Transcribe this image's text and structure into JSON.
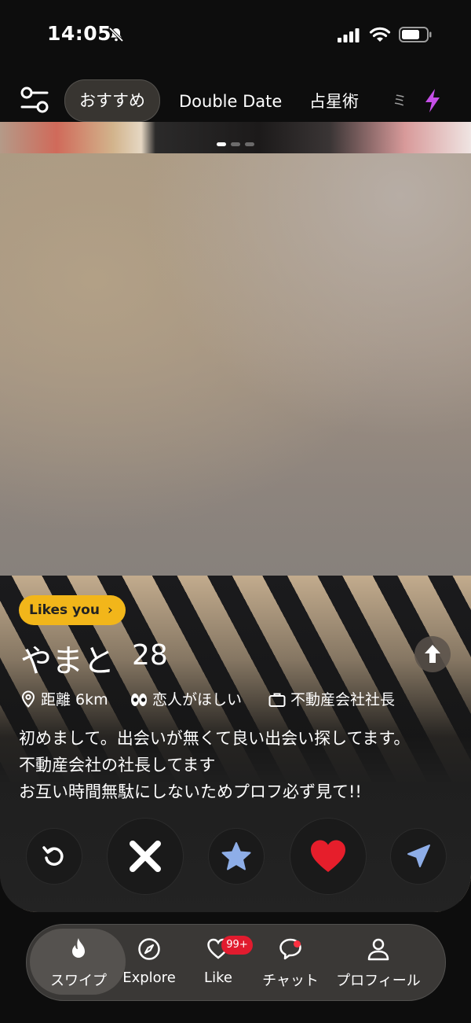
{
  "status_bar": {
    "time": "14:05"
  },
  "top_nav": {
    "tabs": [
      {
        "label": "おすすめ",
        "active": true
      },
      {
        "label": "Double Date"
      },
      {
        "label": "占星術"
      },
      {
        "label": "ミ"
      }
    ]
  },
  "profile": {
    "badge": "Likes you",
    "name": "やまと",
    "age": "28",
    "distance": "距離 6km",
    "looking_for": "恋人がほしい",
    "job": "不動産会社社長",
    "bio_lines": [
      "初めまして。出会いが無くて良い出会い探してます。",
      "不動産会社の社長してます",
      "お互い時間無駄にしないためプロフ必ず見て!!"
    ]
  },
  "tab_bar": {
    "swipe": "スワイプ",
    "explore": "Explore",
    "like": "Like",
    "like_badge": "99+",
    "chat": "チャット",
    "profile": "プロフィール"
  },
  "colors": {
    "badge_yellow": "#f2b61a",
    "like_red": "#e61e2b",
    "super_blue": "#8eaee8",
    "boost_purple": "#c64fe8"
  }
}
